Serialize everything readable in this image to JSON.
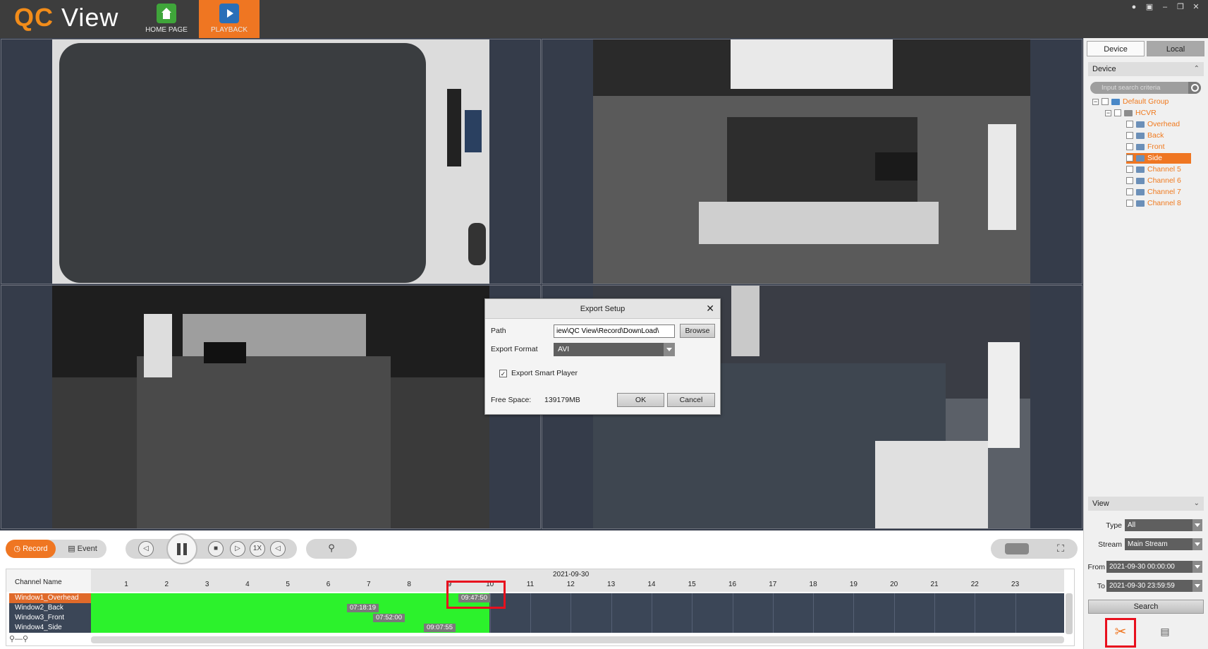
{
  "app": {
    "logo_brand": "QC",
    "logo_rest": "View",
    "nav": [
      {
        "label": "HOME PAGE",
        "icon": "home-icon"
      },
      {
        "label": "PLAYBACK",
        "icon": "playback-icon"
      }
    ],
    "window_controls": [
      "user-icon",
      "lock-icon",
      "minimize-icon",
      "restore-icon",
      "close-icon"
    ]
  },
  "dialog": {
    "title": "Export Setup",
    "path_label": "Path",
    "path_value": "iew\\QC View\\Record\\DownLoad\\",
    "browse_label": "Browse",
    "format_label": "Export Format",
    "format_value": "AVI",
    "smart_player_label": "Export Smart Player",
    "smart_player_checked": true,
    "free_space_label": "Free Space:",
    "free_space_value": "139179MB",
    "ok_label": "OK",
    "cancel_label": "Cancel"
  },
  "right_panel": {
    "tabs": [
      "Device",
      "Local"
    ],
    "device_section": "Device",
    "search_placeholder": "Input search criteria",
    "tree": {
      "group": "Default Group",
      "device": "HCVR",
      "channels": [
        "Overhead",
        "Back",
        "Front",
        "Side",
        "Channel 5",
        "Channel 6",
        "Channel 7",
        "Channel 8"
      ],
      "selected": "Side"
    },
    "view_section": "View",
    "type_label": "Type",
    "type_value": "All",
    "stream_label": "Stream",
    "stream_value": "Main Stream",
    "from_label": "From",
    "from_value": "2021-09-30 00:00:00",
    "to_label": "To",
    "to_value": "2021-09-30 23:59:59",
    "search_label": "Search"
  },
  "controls": {
    "record_label": "Record",
    "event_label": "Event",
    "speed_label": "1X"
  },
  "timeline": {
    "channel_header": "Channel Name",
    "date": "2021-09-30",
    "hours": [
      "1",
      "2",
      "3",
      "4",
      "5",
      "6",
      "7",
      "8",
      "9",
      "10",
      "11",
      "12",
      "13",
      "14",
      "15",
      "16",
      "17",
      "18",
      "19",
      "20",
      "21",
      "22",
      "23"
    ],
    "rows": [
      {
        "name": "Window1_Overhead",
        "stamp": "09:47:50",
        "active": true
      },
      {
        "name": "Window2_Back",
        "stamp": "07:18:19",
        "active": false
      },
      {
        "name": "Window3_Front",
        "stamp": "07:52:00",
        "active": false
      },
      {
        "name": "Window4_Side",
        "stamp": "09:07:55",
        "active": false
      }
    ]
  }
}
